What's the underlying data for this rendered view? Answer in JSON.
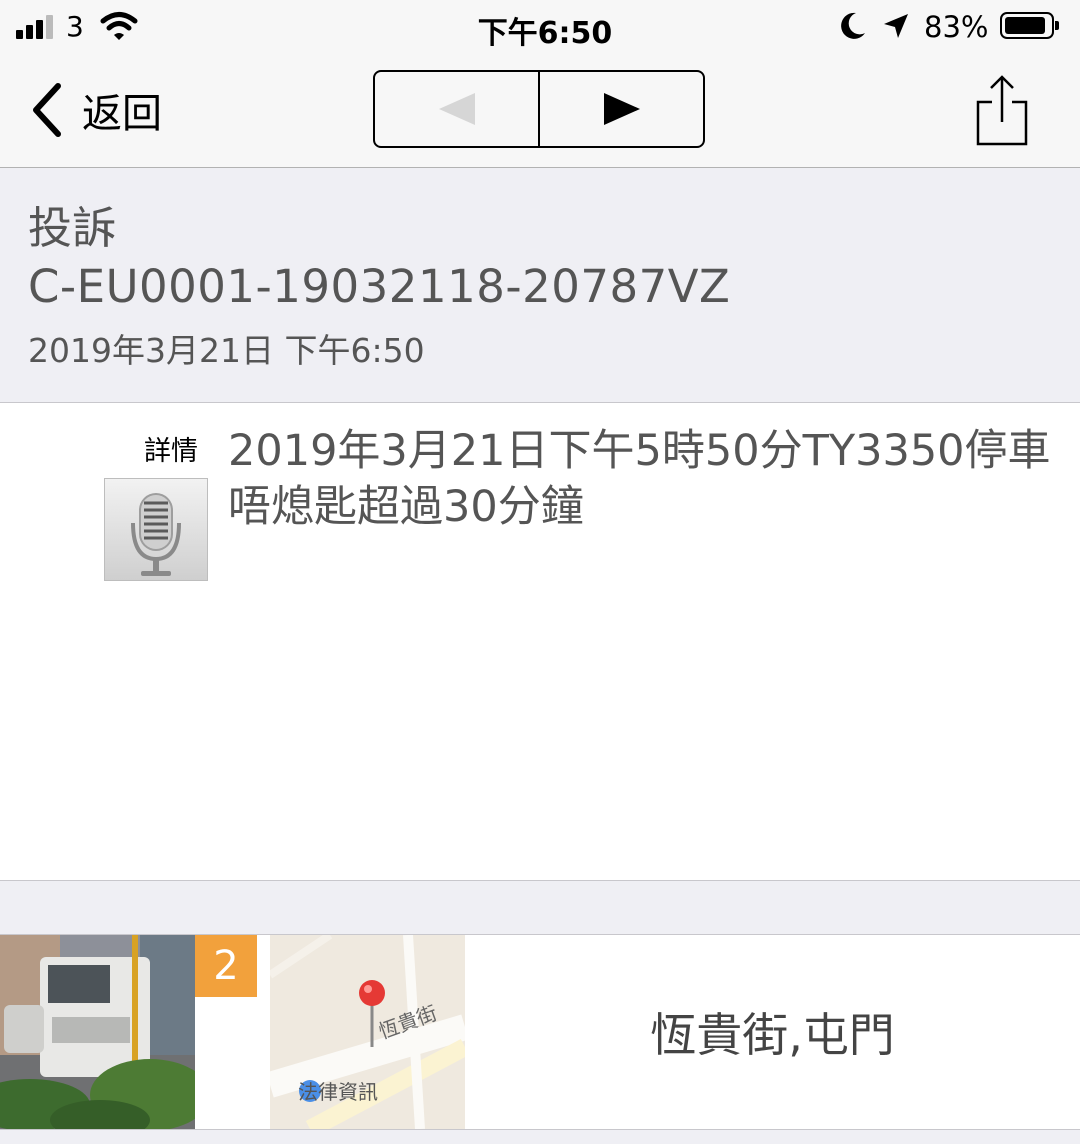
{
  "status_bar": {
    "carrier": "3",
    "time": "下午6:50",
    "battery": "83%"
  },
  "nav": {
    "back_label": "返回",
    "icons": {
      "back": "chevron-left-icon",
      "prev": "triangle-left-icon",
      "next": "triangle-right-icon",
      "share": "share-icon"
    },
    "prev_enabled": false,
    "next_enabled": true
  },
  "header": {
    "type": "投訴",
    "code": "C-EU0001-19032118-20787VZ",
    "date": "2019年3月21日 下午6:50"
  },
  "detail": {
    "label": "詳情",
    "text": "2019年3月21日下午5時50分TY3350停車唔熄匙超過30分鐘",
    "icon": "microphone-icon"
  },
  "location": {
    "photo_count": "2",
    "map_street_label": "恆貴街",
    "map_watermark": "法律資訊",
    "address": "恆貴街,屯門"
  },
  "colors": {
    "badge": "#f2a13c",
    "pin": "#e53935",
    "secondary_text": "#555555",
    "group_background": "#efeff4"
  }
}
